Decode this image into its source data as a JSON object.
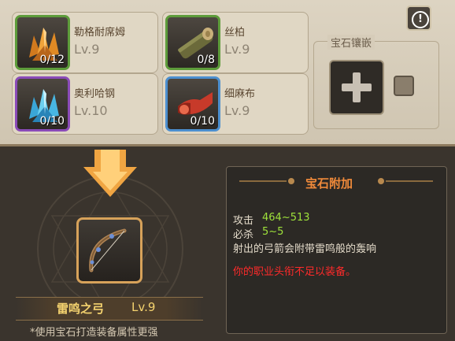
{
  "materials": [
    {
      "name": "勒格耐席姆",
      "level": "Lv.9",
      "count": "0/12",
      "icon": "orange-crystal-icon",
      "rarity_color": "#5d9c3a"
    },
    {
      "name": "丝柏",
      "level": "Lv.9",
      "count": "0/8",
      "icon": "wood-log-icon",
      "rarity_color": "#5d9c3a"
    },
    {
      "name": "奥利哈钢",
      "level": "Lv.10",
      "count": "0/10",
      "icon": "blue-crystal-icon",
      "rarity_color": "#8a4bb8"
    },
    {
      "name": "细麻布",
      "level": "Lv.9",
      "count": "0/10",
      "icon": "red-cloth-icon",
      "rarity_color": "#4c8fcf"
    }
  ],
  "socket": {
    "title": "宝石镶嵌",
    "add_icon": "plus-icon",
    "info_icon": "exclamation-icon"
  },
  "item": {
    "name": "雷鸣之弓",
    "level": "Lv.9",
    "icon": "bow-icon"
  },
  "hint": "*使用宝石打造装备属性更强",
  "attributes": {
    "title": "宝石附加",
    "stats": [
      {
        "label": "攻击",
        "value": "464~513"
      },
      {
        "label": "必杀",
        "value": "5~5"
      }
    ],
    "description": "射出的弓箭会附带雷鸣般的轰响",
    "warning": "你的职业头衔不足以装备。",
    "warning_color": "#ff2a2a",
    "value_color": "#9ee13b"
  }
}
